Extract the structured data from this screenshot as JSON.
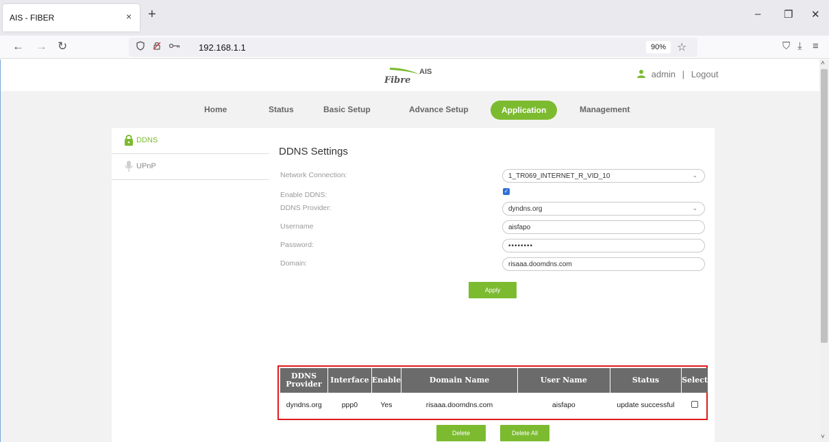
{
  "browser": {
    "tab_title": "AIS - FIBER",
    "tab_close": "×",
    "new_tab": "+",
    "url": "192.168.1.1",
    "zoom": "90%",
    "win_min": "–",
    "win_restore": "❐",
    "win_close": "✕",
    "nav_back": "←",
    "nav_forward": "→",
    "nav_reload": "↻",
    "star": "☆",
    "pocket": "⛉",
    "download": "⤓",
    "menu": "≡"
  },
  "header": {
    "logo_ais": "AIS",
    "logo_fibre": "Fibre",
    "user": "admin",
    "separator": "|",
    "logout": "Logout"
  },
  "menu": {
    "items": [
      "Home",
      "Status",
      "Basic Setup",
      "Advance Setup",
      "Application",
      "Management"
    ],
    "active": "Application"
  },
  "sidebar": {
    "items": [
      {
        "label": "DDNS",
        "icon": "lock-icon",
        "active": true
      },
      {
        "label": "UPnP",
        "icon": "microphone-icon",
        "active": false
      }
    ]
  },
  "ddns": {
    "title": "DDNS Settings",
    "network_connection_label": "Network Connection:",
    "network_connection_value": "1_TR069_INTERNET_R_VID_10",
    "enable_label": "Enable DDNS:",
    "enable_checked": true,
    "provider_label": "DDNS Provider:",
    "provider_value": "dyndns.org",
    "username_label": "Username",
    "username_value": "aisfapo",
    "password_label": "Password:",
    "password_value": "••••••••",
    "domain_label": "Domain:",
    "domain_value": "risaaa.doomdns.com",
    "apply_label": "Apply",
    "delete_label": "Delete",
    "delete_all_label": "Delete All"
  },
  "table": {
    "headers": [
      "DDNS Provider",
      "Interface",
      "Enable",
      "Domain Name",
      "User Name",
      "Status",
      "Select"
    ],
    "rows": [
      [
        "dyndns.org",
        "ppp0",
        "Yes",
        "risaaa.doomdns.com",
        "aisfapo",
        "update successful",
        ""
      ]
    ]
  },
  "colors": {
    "accent": "#7cbb30",
    "table_header": "#6b6b6b",
    "highlight_border": "#e01818"
  }
}
